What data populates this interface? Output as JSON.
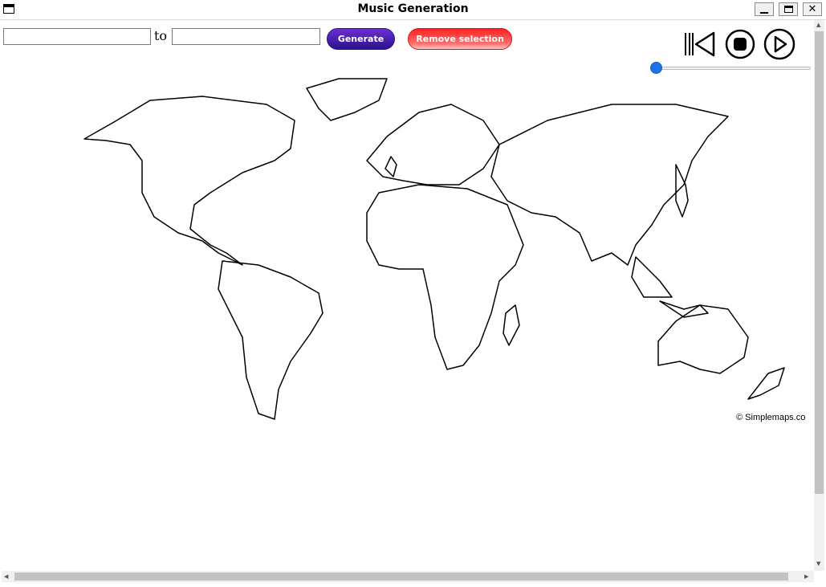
{
  "window": {
    "title": "Music Generation",
    "app_icon": "window-icon",
    "minimize_icon": "minimize-icon",
    "maximize_icon": "maximize-icon",
    "close_glyph": "✕"
  },
  "toolbar": {
    "from_value": "",
    "to_label": "to",
    "to_value": "",
    "generate_label": "Generate",
    "remove_label": "Remove selection",
    "generate_color": "#4b1fb0",
    "remove_color": "#ff2a2a"
  },
  "player": {
    "rewind_icon": "skip-to-start-icon",
    "stop_icon": "stop-icon",
    "play_icon": "play-icon",
    "progress": 0,
    "slider_color": "#1a73e8"
  },
  "map": {
    "credit": "© Simplemaps.co"
  }
}
